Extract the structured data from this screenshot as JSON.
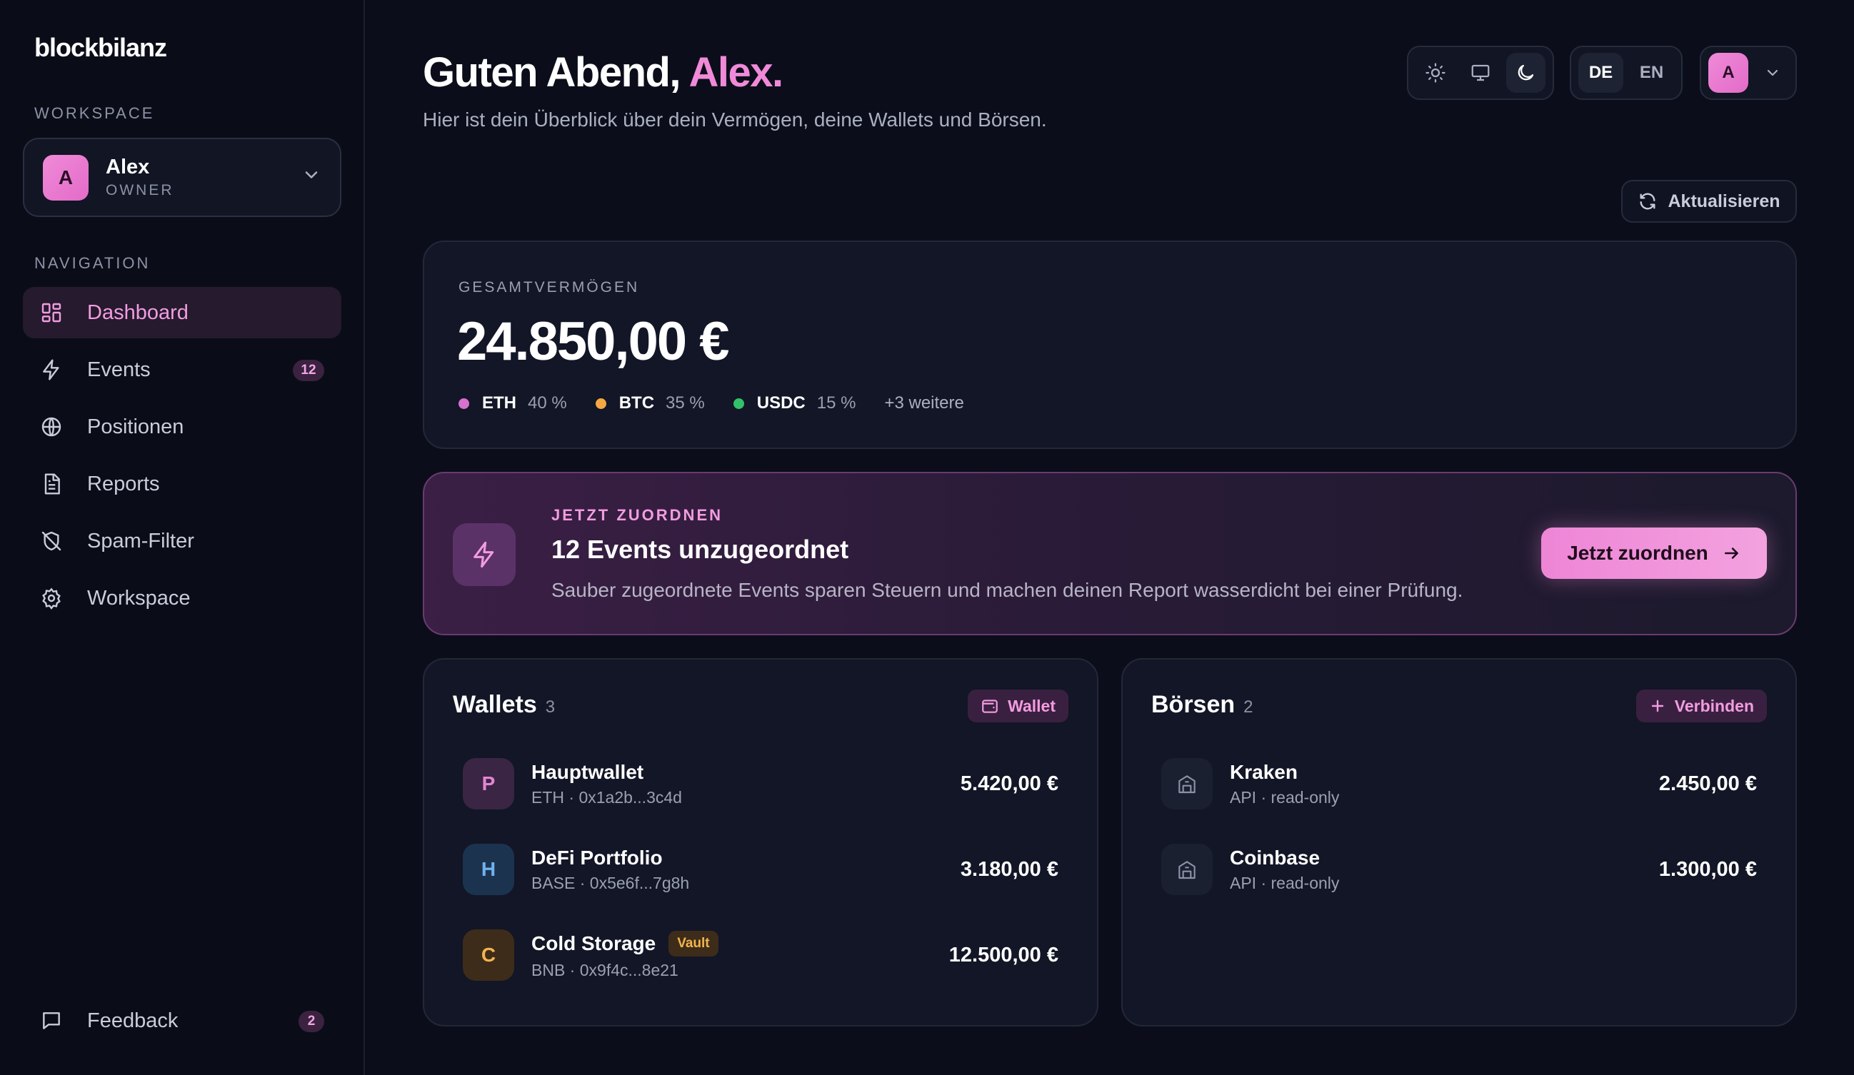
{
  "app": {
    "logo": "blockbilanz"
  },
  "sidebar": {
    "workspace_label": "WORKSPACE",
    "workspace": {
      "avatar": "A",
      "name": "Alex",
      "role": "OWNER"
    },
    "nav_label": "NAVIGATION",
    "items": [
      {
        "label": "Dashboard",
        "icon": "dashboard-icon",
        "active": true
      },
      {
        "label": "Events",
        "icon": "lightning-icon",
        "badge": "12"
      },
      {
        "label": "Positionen",
        "icon": "globe-icon"
      },
      {
        "label": "Reports",
        "icon": "document-icon"
      },
      {
        "label": "Spam-Filter",
        "icon": "shield-off-icon"
      },
      {
        "label": "Workspace",
        "icon": "gear-icon"
      }
    ],
    "feedback": {
      "label": "Feedback",
      "badge": "2",
      "icon": "message-icon"
    }
  },
  "header": {
    "greeting_prefix": "Guten Abend,",
    "greeting_name": "Alex.",
    "subtitle": "Hier ist dein Überblick über dein Vermögen, deine Wallets und Börsen.",
    "theme_options": [
      "sun-icon",
      "monitor-icon",
      "moon-icon"
    ],
    "active_theme": "moon-icon",
    "languages": [
      "DE",
      "EN"
    ],
    "active_language": "DE",
    "user_avatar": "A"
  },
  "refresh_label": "Aktualisieren",
  "total": {
    "label": "GESAMTVERMÖGEN",
    "value": "24.850,00 €",
    "allocation": [
      {
        "symbol": "ETH",
        "pct": "40 %",
        "color": "#d771cf"
      },
      {
        "symbol": "BTC",
        "pct": "35 %",
        "color": "#f4a742"
      },
      {
        "symbol": "USDC",
        "pct": "15 %",
        "color": "#33c06a"
      }
    ],
    "more": "+3 weitere"
  },
  "banner": {
    "eyebrow": "JETZT ZUORDNEN",
    "title": "12 Events unzugeordnet",
    "description": "Sauber zugeordnete Events sparen Steuern und machen deinen Report wasserdicht bei einer Prüfung.",
    "button": "Jetzt zuordnen"
  },
  "wallets": {
    "title": "Wallets",
    "count": "3",
    "action": "Wallet",
    "items": [
      {
        "avatar": "P",
        "name": "Hauptwallet",
        "sub": "ETH · 0x1a2b...3c4d",
        "value": "5.420,00 €",
        "bg": "#3a2544",
        "fg": "#e584d4"
      },
      {
        "avatar": "H",
        "name": "DeFi Portfolio",
        "sub": "BASE · 0x5e6f...7g8h",
        "value": "3.180,00 €",
        "bg": "#1c3350",
        "fg": "#6fb2ee"
      },
      {
        "avatar": "C",
        "name": "Cold Storage",
        "badge": "Vault",
        "sub": "BNB · 0x9f4c...8e21",
        "value": "12.500,00 €",
        "bg": "#3e2c1a",
        "fg": "#f3b44e"
      }
    ]
  },
  "exchanges": {
    "title": "Börsen",
    "count": "2",
    "action": "Verbinden",
    "items": [
      {
        "name": "Kraken",
        "sub": "API · read-only",
        "value": "2.450,00 €",
        "icon": "building-icon"
      },
      {
        "name": "Coinbase",
        "sub": "API · read-only",
        "value": "1.300,00 €",
        "icon": "building-icon"
      }
    ]
  }
}
